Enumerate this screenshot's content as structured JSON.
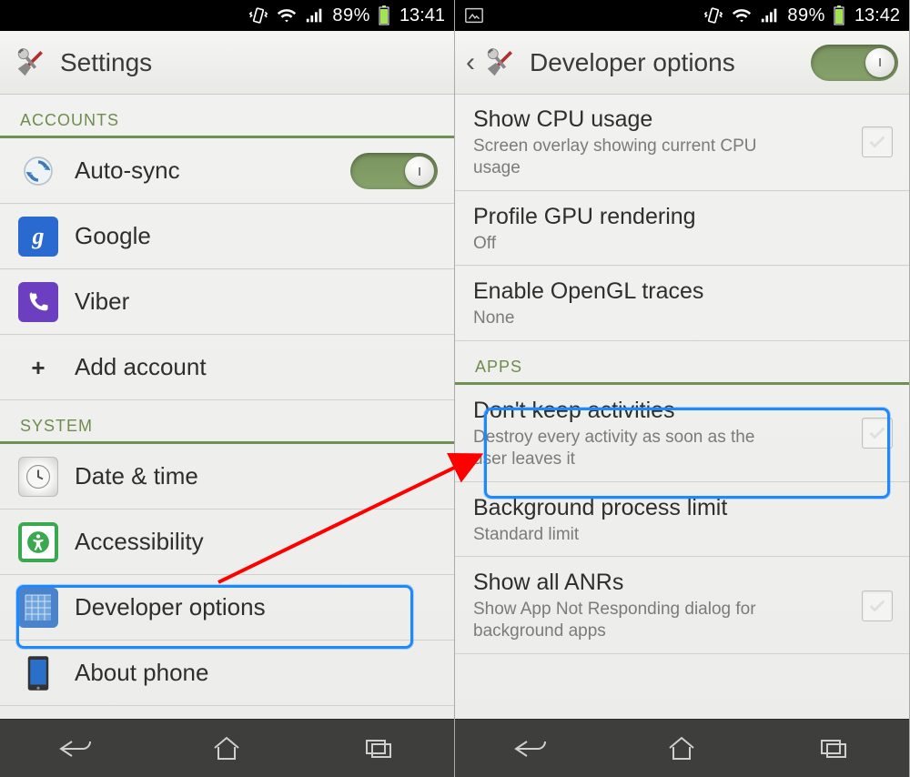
{
  "left": {
    "status": {
      "battery": "89%",
      "time": "13:41"
    },
    "actionbar": {
      "title": "Settings"
    },
    "sections": {
      "accounts": {
        "header": "ACCOUNTS",
        "autosync": "Auto-sync",
        "google": "Google",
        "viber": "Viber",
        "add": "Add account"
      },
      "system": {
        "header": "SYSTEM",
        "datetime": "Date & time",
        "accessibility": "Accessibility",
        "devoptions": "Developer options",
        "about": "About phone"
      }
    }
  },
  "right": {
    "status": {
      "battery": "89%",
      "time": "13:42"
    },
    "actionbar": {
      "title": "Developer options"
    },
    "items": {
      "cpu": {
        "title": "Show CPU usage",
        "sub": "Screen overlay showing current CPU usage"
      },
      "gpu": {
        "title": "Profile GPU rendering",
        "sub": "Off"
      },
      "gl": {
        "title": "Enable OpenGL traces",
        "sub": "None"
      },
      "appsHeader": "APPS",
      "dka": {
        "title": "Don't keep activities",
        "sub": "Destroy every activity as soon as the user leaves it"
      },
      "bpl": {
        "title": "Background process limit",
        "sub": "Standard limit"
      },
      "anr": {
        "title": "Show all ANRs",
        "sub": "Show App Not Responding dialog for background apps"
      }
    }
  }
}
